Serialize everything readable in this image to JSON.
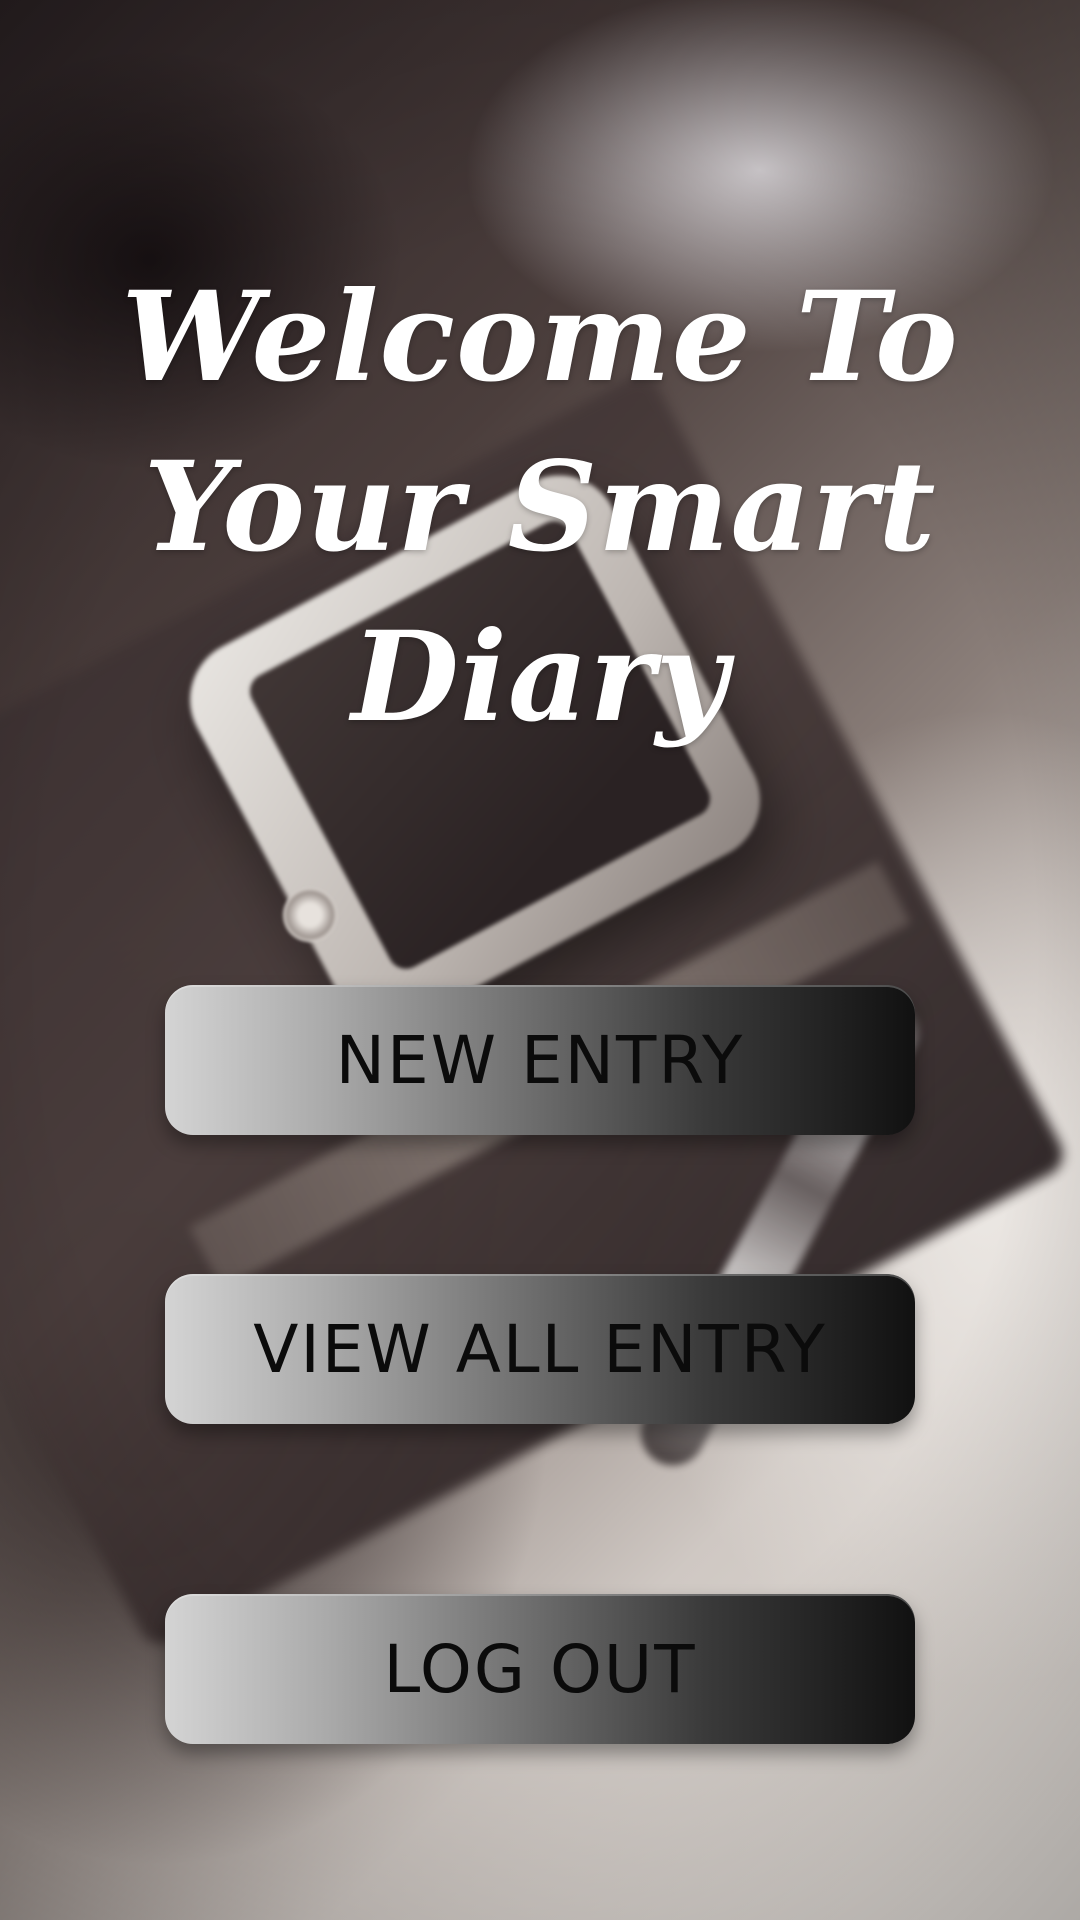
{
  "welcome": {
    "title_lines": [
      "Welcome To",
      "Your Smart",
      "Diary"
    ]
  },
  "actions": {
    "new_entry_label": "NEW ENTRY",
    "view_all_label": "VIEW ALL ENTRY",
    "logout_label": "LOG OUT"
  },
  "colors": {
    "title_text": "#ffffff",
    "button_gradient_start": "#d4d4d4",
    "button_gradient_end": "#111111",
    "button_text": "#0b0b0b"
  }
}
